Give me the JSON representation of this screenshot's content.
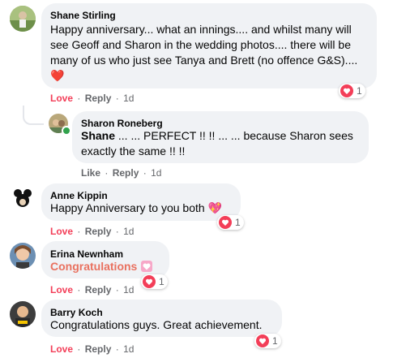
{
  "comments": [
    {
      "author": "Shane Stirling",
      "text": "Happy anniversary... what an innings.... and whilst many will see Geoff and Sharon in the wedding photos.... there will be many of us who just see Tanya and Brett (no offence G&S).... ❤️",
      "action1": "Love",
      "action2": "Reply",
      "time": "1d",
      "reaction_count": "1"
    },
    {
      "author": "Sharon Roneberg",
      "mention": "Shane",
      "text": " ... ... PERFECT !! !! ... ... because Sharon sees exactly the same !! !!",
      "action1": "Like",
      "action2": "Reply",
      "time": "1d"
    },
    {
      "author": "Anne Kippin",
      "text": "Happy Anniversary to you both 💖",
      "action1": "Love",
      "action2": "Reply",
      "time": "1d",
      "reaction_count": "1"
    },
    {
      "author": "Erina Newnham",
      "text": "Congratulations",
      "action1": "Love",
      "action2": "Reply",
      "time": "1d",
      "reaction_count": "1"
    },
    {
      "author": "Barry Koch",
      "text": "Congratulations guys. Great achievement.",
      "action1": "Love",
      "action2": "Reply",
      "time": "1d",
      "reaction_count": "1"
    }
  ],
  "dot": "·",
  "colors": {
    "bubble": "#f0f2f5",
    "love": "#f33e58",
    "meta": "#65676b",
    "congrats": "#e9715f"
  },
  "icons": [
    "love-reaction-icon",
    "online-status-icon",
    "gift-heart-icon"
  ]
}
